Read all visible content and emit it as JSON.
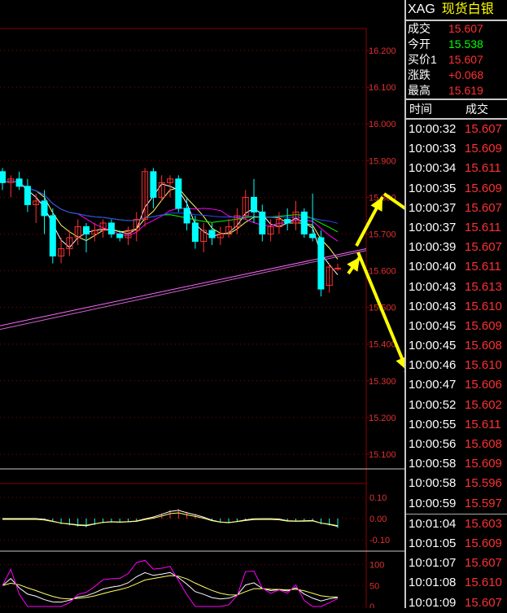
{
  "colors": {
    "up": "#ff3030",
    "down": "#00ffff",
    "grid": "#8b0000",
    "axis_text": "#e03030",
    "ma1": "#ffffff",
    "ma2": "#ffff66",
    "ma3": "#ff00ff",
    "ma4": "#00ff00",
    "ma5": "#3344ff",
    "arrow": "#ffff00"
  },
  "header": {
    "symbol": "XAG",
    "name": "现货白银"
  },
  "quote": [
    {
      "label": "成交",
      "value": "15.607",
      "color": "#ff3030"
    },
    {
      "label": "今开",
      "value": "15.538",
      "color": "#00ff00"
    },
    {
      "label": "买价1",
      "value": "15.607",
      "color": "#ff3030"
    },
    {
      "label": "涨跌",
      "value": "+0.068",
      "color": "#ff3030"
    },
    {
      "label": "最高",
      "value": "15.619",
      "color": "#ff3030"
    }
  ],
  "ticks_header": {
    "time": "时间",
    "price": "成交"
  },
  "ticks": [
    {
      "time": "10:00:32",
      "price": "15.607",
      "color": "#ff3030"
    },
    {
      "time": "10:00:33",
      "price": "15.609",
      "color": "#ff3030"
    },
    {
      "time": "10:00:34",
      "price": "15.611",
      "color": "#ff3030"
    },
    {
      "time": "10:00:35",
      "price": "15.609",
      "color": "#ff3030"
    },
    {
      "time": "10:00:37",
      "price": "15.607",
      "color": "#ff3030"
    },
    {
      "time": "10:00:37",
      "price": "15.611",
      "color": "#ff3030"
    },
    {
      "time": "10:00:39",
      "price": "15.607",
      "color": "#ff3030"
    },
    {
      "time": "10:00:40",
      "price": "15.611",
      "color": "#ff3030"
    },
    {
      "time": "10:00:43",
      "price": "15.613",
      "color": "#ff3030"
    },
    {
      "time": "10:00:43",
      "price": "15.610",
      "color": "#ff3030"
    },
    {
      "time": "10:00:45",
      "price": "15.609",
      "color": "#ff3030"
    },
    {
      "time": "10:00:45",
      "price": "15.608",
      "color": "#ff3030"
    },
    {
      "time": "10:00:46",
      "price": "15.610",
      "color": "#ff3030"
    },
    {
      "time": "10:00:47",
      "price": "15.606",
      "color": "#ff3030"
    },
    {
      "time": "10:00:52",
      "price": "15.602",
      "color": "#ff3030"
    },
    {
      "time": "10:00:55",
      "price": "15.611",
      "color": "#ff3030"
    },
    {
      "time": "10:00:56",
      "price": "15.608",
      "color": "#ff3030"
    },
    {
      "time": "10:00:58",
      "price": "15.609",
      "color": "#ff3030"
    },
    {
      "time": "10:00:58",
      "price": "15.596",
      "color": "#ff3030"
    },
    {
      "time": "10:00:59",
      "price": "15.597",
      "color": "#ff3030"
    },
    {
      "time": "10:01:04",
      "price": "15.603",
      "color": "#ff3030"
    },
    {
      "time": "10:01:05",
      "price": "15.609",
      "color": "#ff3030"
    },
    {
      "time": "10:01:07",
      "price": "15.607",
      "color": "#ff3030"
    },
    {
      "time": "10:01:08",
      "price": "15.610",
      "color": "#ff3030"
    },
    {
      "time": "10:01:09",
      "price": "15.607",
      "color": "#ff3030"
    }
  ],
  "price_axis": [
    "16.200",
    "16.100",
    "16.000",
    "15.900",
    "15.800",
    "15.700",
    "15.600",
    "15.500",
    "15.400",
    "15.300",
    "15.200",
    "15.100"
  ],
  "macd_axis": [
    "0.10",
    "0.00",
    "-0.10"
  ],
  "kdj_axis": [
    "100",
    "50",
    "0"
  ],
  "candles": [
    {
      "o": 15.87,
      "h": 15.88,
      "l": 15.82,
      "c": 15.84
    },
    {
      "o": 15.84,
      "h": 15.86,
      "l": 15.8,
      "c": 15.85
    },
    {
      "o": 15.85,
      "h": 15.87,
      "l": 15.82,
      "c": 15.83
    },
    {
      "o": 15.83,
      "h": 15.85,
      "l": 15.76,
      "c": 15.78
    },
    {
      "o": 15.78,
      "h": 15.81,
      "l": 15.73,
      "c": 15.79
    },
    {
      "o": 15.79,
      "h": 15.82,
      "l": 15.7,
      "c": 15.75
    },
    {
      "o": 15.75,
      "h": 15.77,
      "l": 15.62,
      "c": 15.64
    },
    {
      "o": 15.64,
      "h": 15.69,
      "l": 15.62,
      "c": 15.66
    },
    {
      "o": 15.66,
      "h": 15.71,
      "l": 15.64,
      "c": 15.69
    },
    {
      "o": 15.69,
      "h": 15.74,
      "l": 15.67,
      "c": 15.72
    },
    {
      "o": 15.72,
      "h": 15.73,
      "l": 15.65,
      "c": 15.7
    },
    {
      "o": 15.7,
      "h": 15.73,
      "l": 15.68,
      "c": 15.71
    },
    {
      "o": 15.71,
      "h": 15.74,
      "l": 15.69,
      "c": 15.73
    },
    {
      "o": 15.73,
      "h": 15.74,
      "l": 15.69,
      "c": 15.7
    },
    {
      "o": 15.7,
      "h": 15.71,
      "l": 15.68,
      "c": 15.69
    },
    {
      "o": 15.69,
      "h": 15.72,
      "l": 15.67,
      "c": 15.71
    },
    {
      "o": 15.71,
      "h": 15.76,
      "l": 15.68,
      "c": 15.74
    },
    {
      "o": 15.74,
      "h": 15.88,
      "l": 15.72,
      "c": 15.87
    },
    {
      "o": 15.87,
      "h": 15.88,
      "l": 15.77,
      "c": 15.8
    },
    {
      "o": 15.8,
      "h": 15.86,
      "l": 15.79,
      "c": 15.84
    },
    {
      "o": 15.84,
      "h": 15.86,
      "l": 15.8,
      "c": 15.85
    },
    {
      "o": 15.85,
      "h": 15.86,
      "l": 15.76,
      "c": 15.77
    },
    {
      "o": 15.77,
      "h": 15.8,
      "l": 15.71,
      "c": 15.73
    },
    {
      "o": 15.73,
      "h": 15.75,
      "l": 15.66,
      "c": 15.68
    },
    {
      "o": 15.68,
      "h": 15.73,
      "l": 15.65,
      "c": 15.71
    },
    {
      "o": 15.71,
      "h": 15.73,
      "l": 15.67,
      "c": 15.69
    },
    {
      "o": 15.69,
      "h": 15.72,
      "l": 15.67,
      "c": 15.7
    },
    {
      "o": 15.7,
      "h": 15.74,
      "l": 15.69,
      "c": 15.72
    },
    {
      "o": 15.72,
      "h": 15.77,
      "l": 15.7,
      "c": 15.75
    },
    {
      "o": 15.75,
      "h": 15.82,
      "l": 15.74,
      "c": 15.8
    },
    {
      "o": 15.8,
      "h": 15.85,
      "l": 15.73,
      "c": 15.76
    },
    {
      "o": 15.76,
      "h": 15.78,
      "l": 15.68,
      "c": 15.7
    },
    {
      "o": 15.7,
      "h": 15.74,
      "l": 15.68,
      "c": 15.72
    },
    {
      "o": 15.72,
      "h": 15.76,
      "l": 15.7,
      "c": 15.74
    },
    {
      "o": 15.74,
      "h": 15.77,
      "l": 15.71,
      "c": 15.73
    },
    {
      "o": 15.73,
      "h": 15.79,
      "l": 15.71,
      "c": 15.76
    },
    {
      "o": 15.76,
      "h": 15.77,
      "l": 15.69,
      "c": 15.7
    },
    {
      "o": 15.7,
      "h": 15.81,
      "l": 15.68,
      "c": 15.69
    },
    {
      "o": 15.69,
      "h": 15.71,
      "l": 15.53,
      "c": 15.55
    },
    {
      "o": 15.56,
      "h": 15.62,
      "l": 15.54,
      "c": 15.61
    },
    {
      "o": 15.607,
      "h": 15.619,
      "l": 15.6,
      "c": 15.607
    }
  ]
}
